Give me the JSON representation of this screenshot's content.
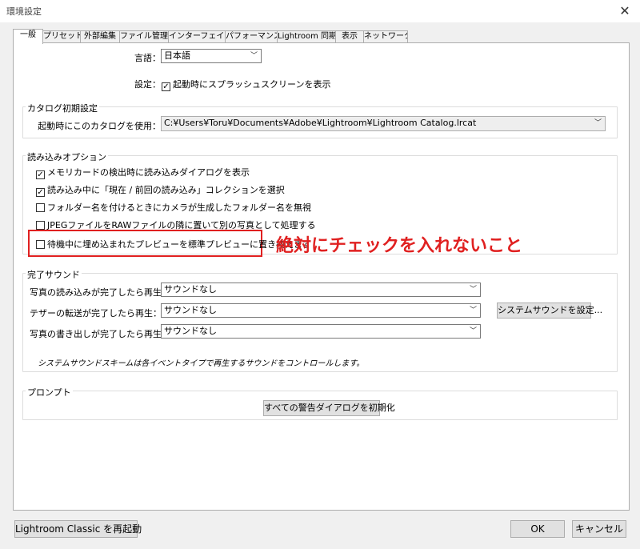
{
  "window": {
    "title": "環境設定",
    "close_icon": "close-icon"
  },
  "tabs": [
    {
      "label": "一般",
      "active": true
    },
    {
      "label": "プリセット"
    },
    {
      "label": "外部編集"
    },
    {
      "label": "ファイル管理"
    },
    {
      "label": "インターフェイス"
    },
    {
      "label": "パフォーマンス"
    },
    {
      "label": "Lightroom 同期"
    },
    {
      "label": "表示"
    },
    {
      "label": "ネットワーク"
    }
  ],
  "general": {
    "language_label": "言語：",
    "language_value": "日本語",
    "settings_label": "設定：",
    "splash_label": "起動時にスプラッシュスクリーンを表示",
    "splash_checked": true
  },
  "catalog": {
    "group_title": "カタログ初期設定",
    "label": "起動時にこのカタログを使用：",
    "value": "C:¥Users¥Toru¥Documents¥Adobe¥Lightroom¥Lightroom Catalog.lrcat"
  },
  "import": {
    "group_title": "読み込みオプション",
    "options": [
      {
        "label": "メモリカードの検出時に読み込みダイアログを表示",
        "checked": true
      },
      {
        "label": "読み込み中に「現在 / 前回の読み込み」コレクションを選択",
        "checked": true
      },
      {
        "label": "フォルダー名を付けるときにカメラが生成したフォルダー名を無視",
        "checked": false
      },
      {
        "label": "JPEGファイルをRAWファイルの隣に置いて別の写真として処理する",
        "checked": false
      },
      {
        "label": "待機中に埋め込まれたプレビューを標準プレビューに置き換えます",
        "checked": false
      }
    ],
    "annotation": "絶対にチェックを入れないこと",
    "annotation_color": "#e02020"
  },
  "sound": {
    "group_title": "完了サウンド",
    "rows": [
      {
        "label": "写真の読み込みが完了したら再生：",
        "value": "サウンドなし"
      },
      {
        "label": "テザーの転送が完了したら再生：",
        "value": "サウンドなし"
      },
      {
        "label": "写真の書き出しが完了したら再生：",
        "value": "サウンドなし"
      }
    ],
    "system_sound_button": "システムサウンドを設定...",
    "note": "システムサウンドスキームは各イベントタイプで再生するサウンドをコントロールします。"
  },
  "prompt": {
    "group_title": "プロンプト",
    "reset_button": "すべての警告ダイアログを初期化"
  },
  "footer": {
    "restart_button": "Lightroom Classic を再起動",
    "ok_button": "OK",
    "cancel_button": "キャンセル"
  }
}
